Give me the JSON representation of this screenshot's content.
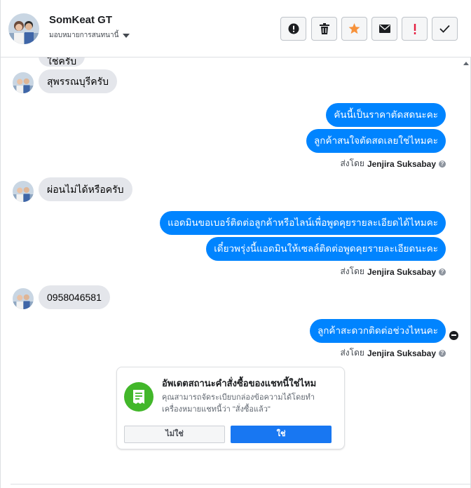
{
  "header": {
    "contact_name": "SomKeat GT",
    "assign_label": "มอบหมายการสนทนานี้",
    "actions": [
      {
        "name": "spam-button",
        "icon": "exclamation-circle-icon"
      },
      {
        "name": "delete-button",
        "icon": "trash-icon"
      },
      {
        "name": "star-button",
        "icon": "star-icon",
        "color": "#f7923b"
      },
      {
        "name": "mark-unread-button",
        "icon": "envelope-icon"
      },
      {
        "name": "follow-up-button",
        "icon": "exclamation-mark-icon",
        "color": "#e41e3f"
      },
      {
        "name": "mark-done-button",
        "icon": "checkmark-icon"
      }
    ]
  },
  "messages": {
    "cut_off_text": "ใช่ครับ",
    "in_1": "สุพรรณบุรีครับ",
    "out_1a": "คันนี้เป็นราคาตัดสดนะคะ",
    "out_1b": "ลูกค้าสนใจตัดสดเลยใช่ไหมคะ",
    "in_2": "ผ่อนไม่ได้หรือครับ",
    "out_2a": "แอดมินขอเบอร์ติดต่อลูกค้าหรือไลน์เพื่อพูดคุยรายละเอียดได้ไหมคะ",
    "out_2b": "เดี๋ยวพรุ่งนี้แอดมินให้เซลล์ติดต่อพูดคุยรายละเอียดนะคะ",
    "in_3": "0958046581",
    "out_3a": "ลูกค้าสะดวกติดต่อช่วงไหนคะ",
    "sent_by_prefix": "ส่งโดย",
    "sent_by_name": "Jenjira Suksabay"
  },
  "order_card": {
    "title": "อัพเดตสถานะคำสั่งซื้อของแชทนี้ใช่ไหม",
    "body": "คุณสามารถจัดระเบียบกล่องข้อความได้โดยทำเครื่องหมายแชทนี้ว่า \"สั่งซื้อแล้ว\"",
    "no_label": "ไม่ใช่",
    "yes_label": "ใช่"
  },
  "colors": {
    "outgoing_bubble": "#0084ff",
    "incoming_bubble": "#e4e6eb",
    "yes_button": "#1877f2",
    "card_icon": "#42b72a"
  }
}
